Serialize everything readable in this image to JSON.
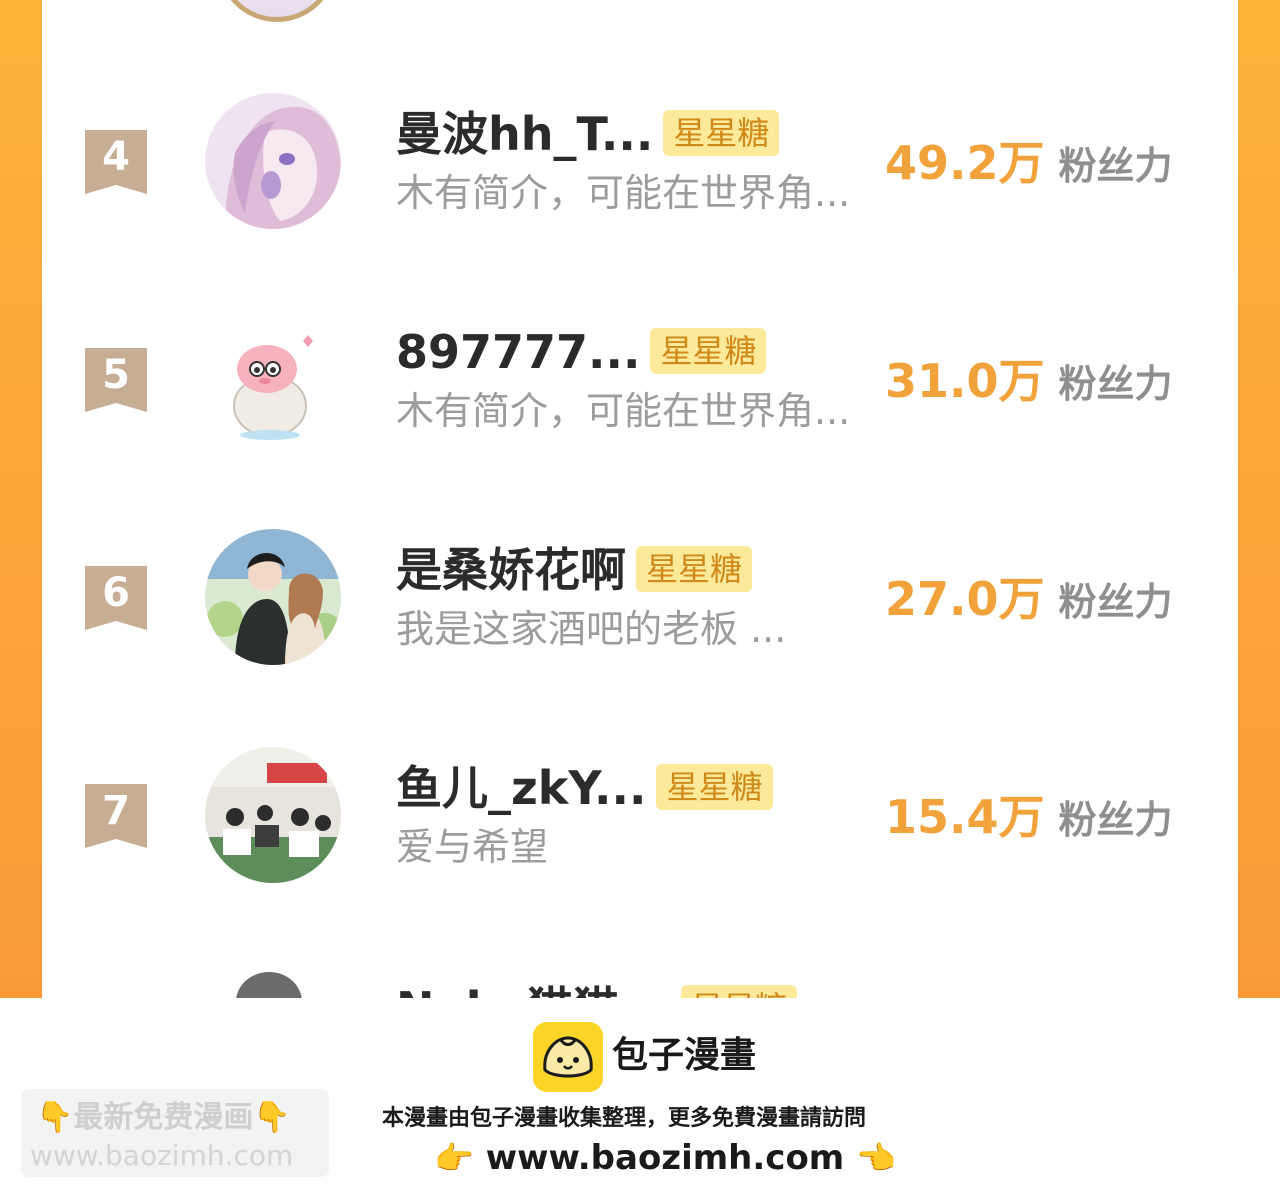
{
  "rows": [
    {
      "rank": "4",
      "name": "曼波hh_T...",
      "tag": "星星糖",
      "desc": "木有简介，可能在世界角...",
      "fans_value": "49.2万",
      "fans_unit": "粉丝力"
    },
    {
      "rank": "5",
      "name": "897777...",
      "tag": "星星糖",
      "desc": "木有简介，可能在世界角...",
      "fans_value": "31.0万",
      "fans_unit": "粉丝力"
    },
    {
      "rank": "6",
      "name": "是桑娇花啊",
      "tag": "星星糖",
      "desc": "我是这家酒吧的老板 ...",
      "fans_value": "27.0万",
      "fans_unit": "粉丝力"
    },
    {
      "rank": "7",
      "name": "鱼儿_zkY...",
      "tag": "星星糖",
      "desc": "爱与希望",
      "fans_value": "15.4万",
      "fans_unit": "粉丝力"
    }
  ],
  "partial_row": {
    "name": "Neko猫猫...",
    "tag": "星星糖"
  },
  "footer": {
    "logo_title": "包子漫畫",
    "tagline": "本漫畫由包子漫畫收集整理，更多免費漫畫請訪問",
    "site": "www.baozimh.com",
    "hand_left": "👉",
    "hand_right": "👈"
  },
  "watermark": {
    "line1": "👇最新免费漫画👇",
    "line2": "www.baozimh.com"
  },
  "colors": {
    "frame": "#fca43a",
    "rank_badge": "#c7ad93",
    "fans_number": "#f2a23a",
    "tag_bg": "#fde99a",
    "logo_yellow": "#fbd428"
  }
}
